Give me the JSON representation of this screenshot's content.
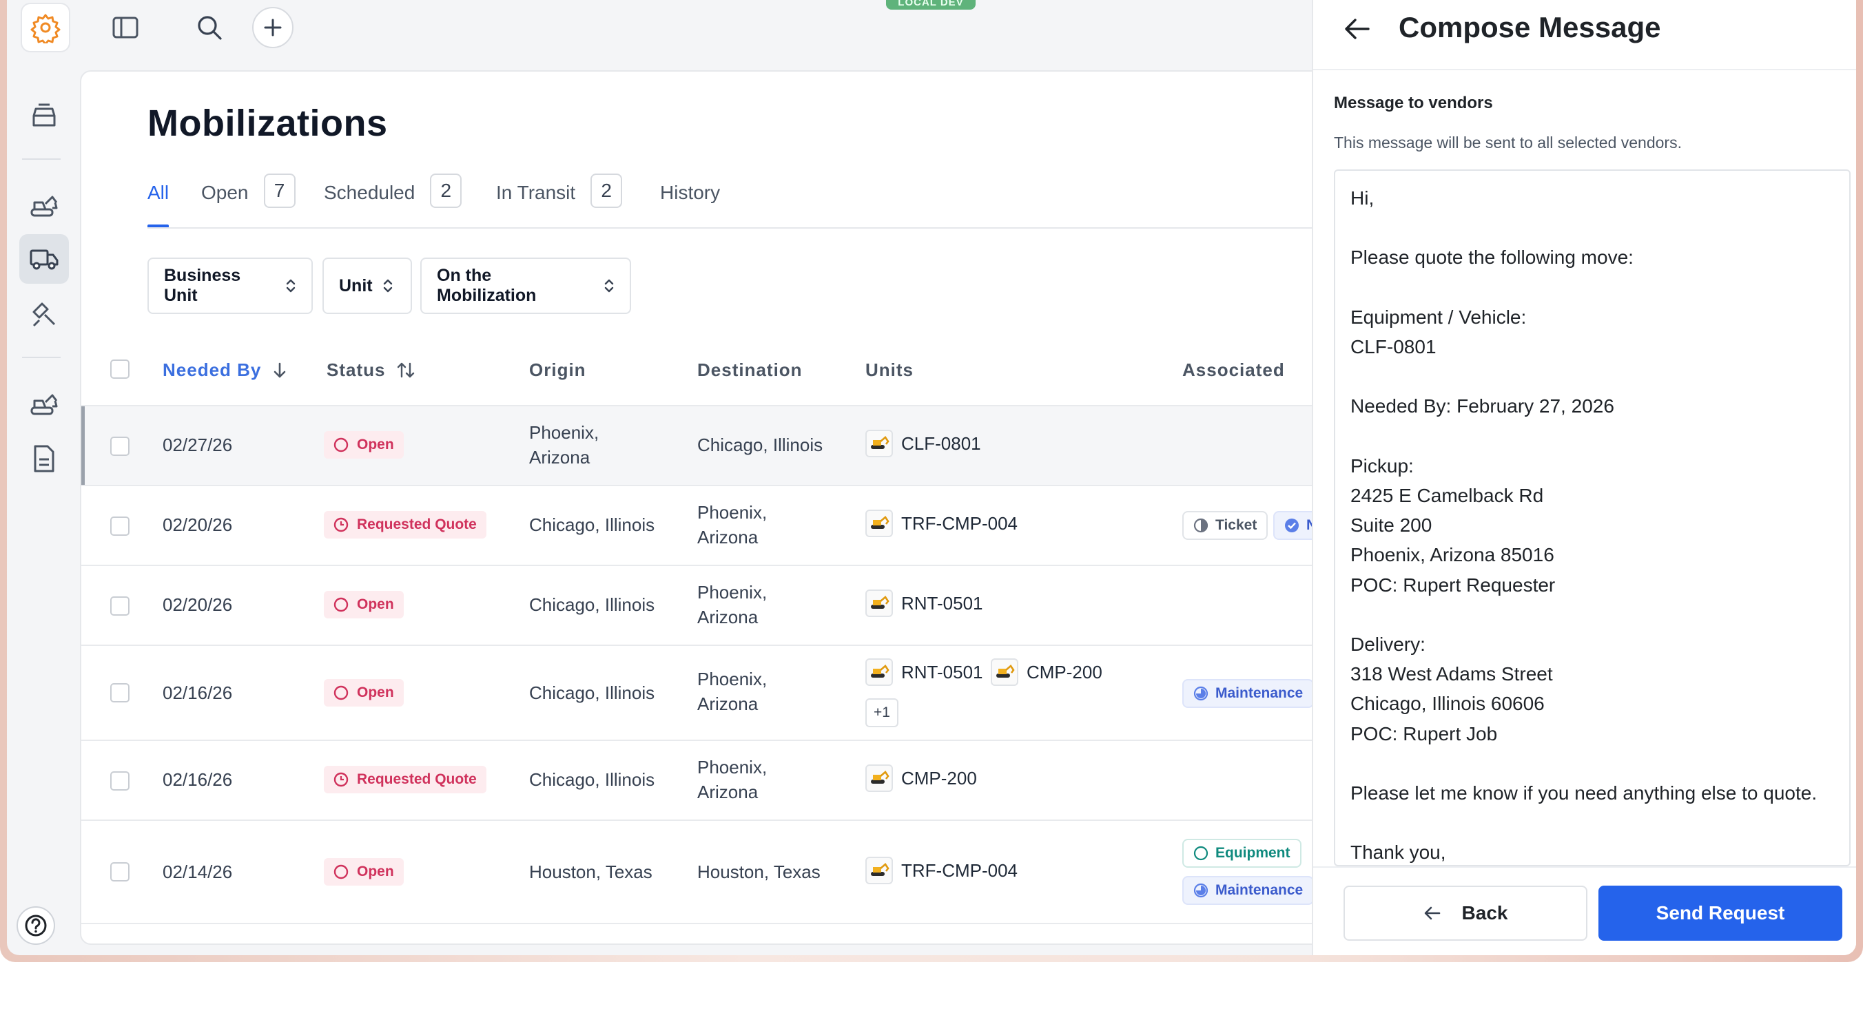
{
  "env_badge": "LOCAL DEV",
  "page": {
    "title": "Mobilizations",
    "tabs": [
      {
        "label": "All",
        "count": null,
        "active": true
      },
      {
        "label": "Open",
        "count": "7"
      },
      {
        "label": "Scheduled",
        "count": "2"
      },
      {
        "label": "In Transit",
        "count": "2"
      },
      {
        "label": "History",
        "count": null
      }
    ],
    "filters": [
      "Business Unit",
      "Unit",
      "On the Mobilization"
    ]
  },
  "table": {
    "headers": {
      "needed_by": "Needed By",
      "status": "Status",
      "origin": "Origin",
      "destination": "Destination",
      "units": "Units",
      "associated": "Associated"
    },
    "rows": [
      {
        "needed_by": "02/27/26",
        "status": "Open",
        "origin": [
          "Phoenix,",
          "Arizona"
        ],
        "destination": [
          "Chicago, Illinois"
        ],
        "units": [
          "CLF-0801"
        ],
        "extra_units": null,
        "associated": []
      },
      {
        "needed_by": "02/20/26",
        "status": "Requested Quote",
        "origin": [
          "Chicago, Illinois"
        ],
        "destination": [
          "Phoenix,",
          "Arizona"
        ],
        "units": [
          "TRF-CMP-004"
        ],
        "extra_units": null,
        "associated": [
          "Ticket",
          "N"
        ]
      },
      {
        "needed_by": "02/20/26",
        "status": "Open",
        "origin": [
          "Chicago, Illinois"
        ],
        "destination": [
          "Phoenix,",
          "Arizona"
        ],
        "units": [
          "RNT-0501"
        ],
        "extra_units": null,
        "associated": []
      },
      {
        "needed_by": "02/16/26",
        "status": "Open",
        "origin": [
          "Chicago, Illinois"
        ],
        "destination": [
          "Phoenix,",
          "Arizona"
        ],
        "units": [
          "RNT-0501",
          "CMP-200"
        ],
        "extra_units": "+1",
        "associated": [
          "Maintenance"
        ]
      },
      {
        "needed_by": "02/16/26",
        "status": "Requested Quote",
        "origin": [
          "Chicago, Illinois"
        ],
        "destination": [
          "Phoenix,",
          "Arizona"
        ],
        "units": [
          "CMP-200"
        ],
        "extra_units": null,
        "associated": []
      },
      {
        "needed_by": "02/14/26",
        "status": "Open",
        "origin": [
          "Houston, Texas"
        ],
        "destination": [
          "Houston, Texas"
        ],
        "units": [
          "TRF-CMP-004"
        ],
        "extra_units": null,
        "associated": [
          "Equipment",
          "Maintenance"
        ]
      }
    ]
  },
  "compose": {
    "title": "Compose Message",
    "label": "Message to vendors",
    "helper": "This message will be sent to all selected vendors.",
    "message": "Hi,\n\nPlease quote the following move:\n\nEquipment / Vehicle:\nCLF-0801\n\nNeeded By: February 27, 2026\n\nPickup:\n2425 E Camelback Rd\nSuite 200\nPhoenix, Arizona 85016\nPOC: Rupert Requester\n\nDelivery:\n318 West Adams Street\nChicago, Illinois 60606\nPOC: Rupert Job\n\nPlease let me know if you need anything else to quote.\n\nThank you,",
    "back_label": "Back",
    "send_label": "Send Request"
  },
  "colors": {
    "accent": "#2563eb",
    "status_pink": "#d0325c",
    "logo_orange": "#f08a24"
  },
  "icons": {
    "logo": "gear-logo-icon",
    "sidebar_toggle": "sidebar-toggle-icon",
    "search": "search-icon",
    "add": "plus-icon",
    "help": "help-icon"
  }
}
